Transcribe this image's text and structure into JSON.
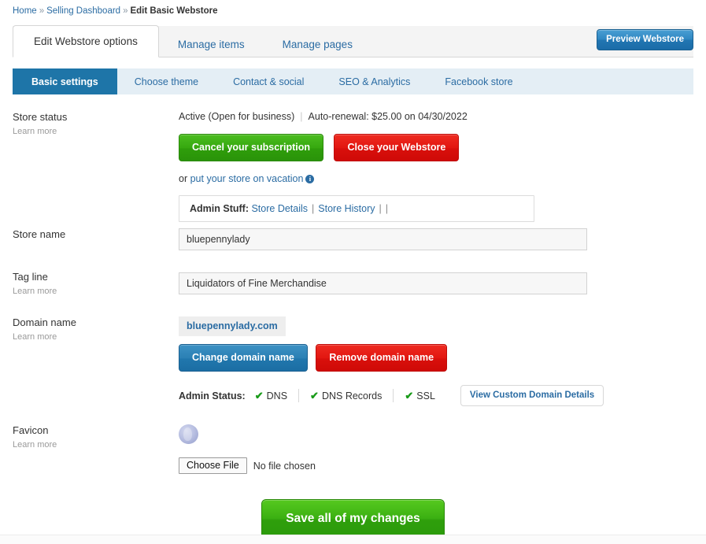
{
  "breadcrumb": {
    "home": "Home",
    "selling_dashboard": "Selling Dashboard",
    "current": "Edit Basic Webstore",
    "separator": "»"
  },
  "tabs": [
    {
      "label": "Edit Webstore options",
      "active": true
    },
    {
      "label": "Manage items",
      "active": false
    },
    {
      "label": "Manage pages",
      "active": false
    }
  ],
  "preview_button": "Preview Webstore",
  "subnav": [
    {
      "label": "Basic settings",
      "active": true
    },
    {
      "label": "Choose theme",
      "active": false
    },
    {
      "label": "Contact & social",
      "active": false
    },
    {
      "label": "SEO & Analytics",
      "active": false
    },
    {
      "label": "Facebook store",
      "active": false
    }
  ],
  "learn_more": "Learn more",
  "store_status": {
    "label": "Store status",
    "state": "Active (Open for business)",
    "renewal": "Auto-renewal: $25.00 on 04/30/2022",
    "cancel_button": "Cancel your subscription",
    "close_button": "Close your Webstore",
    "or_text": "or",
    "vacation_link": "put your store on vacation",
    "info_icon_glyph": "i",
    "admin_stuff_label": "Admin Stuff:",
    "admin_link_1": "Store Details",
    "admin_link_2": "Store History",
    "admin_pipe": "|"
  },
  "store_name": {
    "label": "Store name",
    "value": "bluepennylady",
    "placeholder": "Store name"
  },
  "tag_line": {
    "label": "Tag line",
    "value": "Liquidators of Fine Merchandise",
    "placeholder": "Tag line"
  },
  "domain_name": {
    "label": "Domain name",
    "domain": "bluepennylady.com",
    "change_button": "Change domain name",
    "remove_button": "Remove domain name",
    "admin_status_label": "Admin Status:",
    "statuses": [
      "DNS",
      "DNS Records",
      "SSL"
    ],
    "check_glyph": "✔",
    "details_button": "View Custom Domain Details"
  },
  "favicon": {
    "label": "Favicon",
    "choose_file_button": "Choose File",
    "no_file_text": "No file chosen"
  },
  "save_button": "Save all of my changes",
  "colors": {
    "link_blue": "#2b6ca3",
    "active_nav_blue": "#1e75a8",
    "subnav_bg": "#e4eef5",
    "green": "#2f9e0b",
    "red": "#d9100c",
    "check_green": "#1a9b1a"
  }
}
